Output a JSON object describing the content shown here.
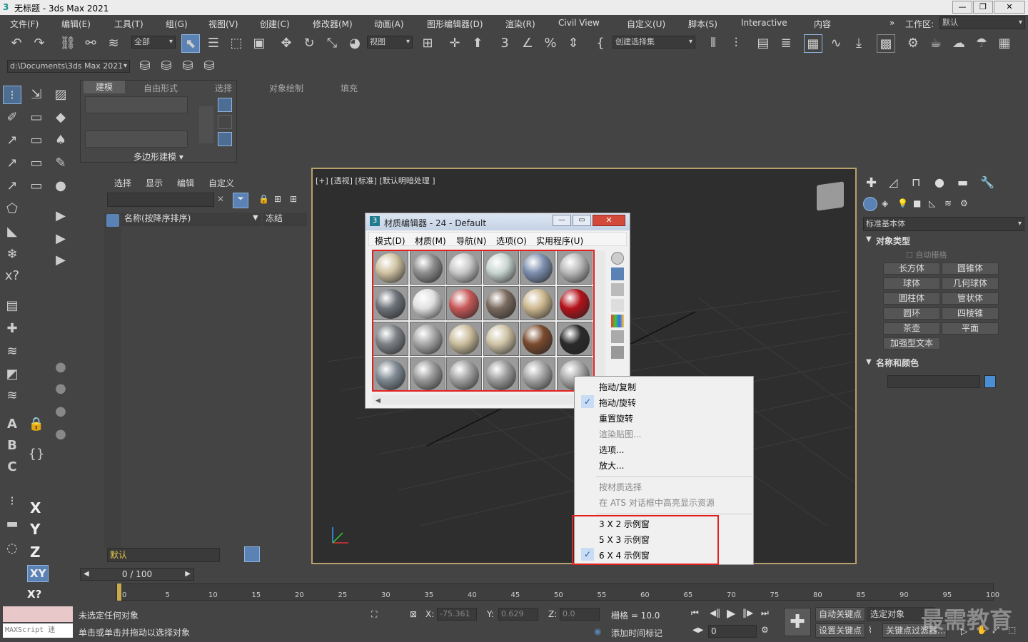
{
  "app": {
    "title": "无标题 - 3ds Max 2021"
  },
  "menu": [
    "文件(F)",
    "编辑(E)",
    "工具(T)",
    "组(G)",
    "视图(V)",
    "创建(C)",
    "修改器(M)",
    "动画(A)",
    "图形编辑器(D)",
    "渲染(R)",
    "Civil View",
    "自定义(U)",
    "脚本(S)",
    "Interactive",
    "内容"
  ],
  "workspace": {
    "label": "工作区:",
    "value": "默认"
  },
  "toolbar": {
    "filter": "全部",
    "refcoord": "视图",
    "selset": "创建选择集",
    "path": "d:\\Documents\\3ds Max 2021"
  },
  "ribbon": {
    "tabs": [
      "建模",
      "自由形式",
      "选择",
      "对象绘制",
      "填充"
    ],
    "panel": "多边形建模 ▾"
  },
  "scene": {
    "tabs": [
      "选择",
      "显示",
      "编辑",
      "自定义"
    ],
    "col_name": "名称(按降序排序)",
    "col_freeze": "冻结",
    "layer": "默认"
  },
  "viewport": {
    "label": "[+] [透视] [标准] [默认明暗处理 ]"
  },
  "mat": {
    "title": "材质编辑器 - 24 - Default",
    "menu": [
      "模式(D)",
      "材质(M)",
      "导航(N)",
      "选项(O)",
      "实用程序(U)"
    ],
    "colors": [
      "#cfc2a2",
      "#8e8e8e",
      "#c8c8c8",
      "#c9d5d0",
      "#7d8faf",
      "#b9b9b9",
      "#6e737a",
      "#e0e0e0",
      "#c75858",
      "#7a6a5e",
      "#cdb88f",
      "#b4121a",
      "#7d8186",
      "#a8a8a8",
      "#cbbd9c",
      "#cfc3a6",
      "#7a4a2e",
      "#2a2a2a",
      "#7f8a93",
      "#9a9a9a",
      "#a3a3a3",
      "#9d9d9d",
      "#a6a6a6",
      "#aaaaaa"
    ]
  },
  "ctx": {
    "items": [
      "拖动/复制",
      "拖动/旋转",
      "重置旋转",
      "渲染贴图...",
      "选项...",
      "放大...",
      "按材质选择",
      "在 ATS 对话框中高亮显示资源",
      "3 X 2 示例窗",
      "5 X 3 示例窗",
      "6 X 4 示例窗"
    ]
  },
  "cmd": {
    "category": "标准基本体",
    "objtype": "对象类型",
    "autogrid": "自动栅格",
    "buttons": [
      "长方体",
      "圆锥体",
      "球体",
      "几何球体",
      "圆柱体",
      "管状体",
      "圆环",
      "四棱锥",
      "茶壶",
      "平面",
      "加强型文本"
    ],
    "namecolor": "名称和颜色",
    "objcolor": "#4a8fd6"
  },
  "timeline": {
    "frame": "0 / 100",
    "ticks": [
      "0",
      "5",
      "10",
      "15",
      "20",
      "25",
      "30",
      "35",
      "40",
      "45",
      "50",
      "55",
      "60",
      "65",
      "70",
      "75",
      "80",
      "85",
      "90",
      "95",
      "100"
    ]
  },
  "status": {
    "maxscript": "MAXScript 迷",
    "line1": "未选定任何对象",
    "line2": "单击或单击并拖动以选择对象",
    "x": "-75.361",
    "y": "0.629",
    "z": "0.0",
    "grid": "栅格 = 10.0",
    "addtime": "添加时间标记",
    "autokey": "自动关键点",
    "selobj": "选定对象",
    "setkey": "设置关键点",
    "keyfilter": "关键点过滤器...",
    "frame": "0",
    "watermark": "最需教育"
  },
  "labels": {
    "x": "X:",
    "y": "Y:",
    "z": "Z:"
  }
}
